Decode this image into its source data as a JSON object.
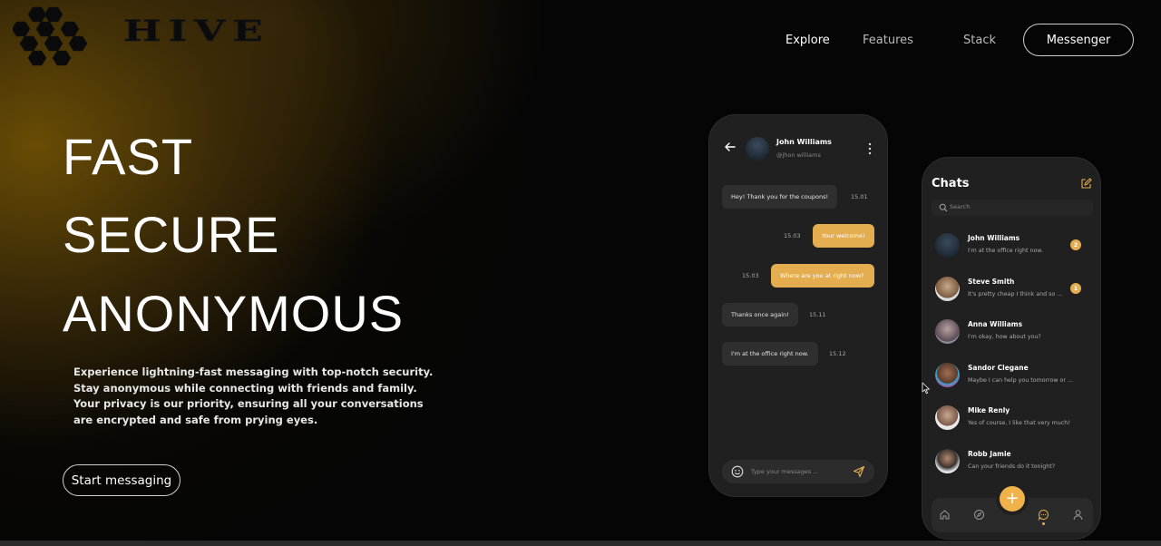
{
  "header": {
    "brand": "HIVE",
    "nav": {
      "explore": "Explore",
      "features": "Features",
      "stack": "Stack"
    },
    "messenger_button": "Messenger"
  },
  "hero": {
    "lines": [
      "FAST",
      "SECURE",
      "ANONYMOUS"
    ],
    "description": [
      "Experience lightning-fast messaging with top-notch security.",
      "Stay anonymous while connecting with friends and family.",
      "Your privacy is our priority, ensuring all your conversations",
      "are encrypted and safe from prying eyes."
    ],
    "cta": "Start messaging"
  },
  "chat_phone": {
    "contact_name": "John Williams",
    "contact_handle": "@jhon williams",
    "messages": [
      {
        "text": "Hey! Thank you for the coupons!",
        "time": "15.01",
        "direction": "in"
      },
      {
        "text": "Your welcome!",
        "time": "15.03",
        "direction": "out"
      },
      {
        "text": "Where are you at right now?",
        "time": "15.03",
        "direction": "out"
      },
      {
        "text": "Thanks once again!",
        "time": "15.11",
        "direction": "in"
      },
      {
        "text": "I'm at the office right now.",
        "time": "15.12",
        "direction": "in"
      }
    ],
    "input_placeholder": "Type your messages ..."
  },
  "chats_phone": {
    "title": "Chats",
    "search_placeholder": "Search",
    "chats": [
      {
        "name": "John Williams",
        "message": "I'm at the office right now.",
        "badge": "2"
      },
      {
        "name": "Steve Smith",
        "message": "It's pretty cheap I think and so ...",
        "badge": "1"
      },
      {
        "name": "Anna Williams",
        "message": "I'm okay, how about you?",
        "badge": ""
      },
      {
        "name": "Sandor Clegane",
        "message": "Maybe I can help you tomorrow or ...",
        "badge": ""
      },
      {
        "name": "Mike Renly",
        "message": "Yes of course, I like that very much!",
        "badge": ""
      },
      {
        "name": "Robb Jamie",
        "message": "Can your friends do it tonight?",
        "badge": ""
      }
    ],
    "fab_label": "+"
  },
  "colors": {
    "accent": "#e4ae50",
    "background": "#050505",
    "phone": "#202020"
  },
  "icons": [
    "honeycomb-logo-icon",
    "back-arrow-icon",
    "more-vertical-icon",
    "emoji-icon",
    "send-icon",
    "edit-icon",
    "search-icon",
    "home-icon",
    "compass-icon",
    "chat-bubble-icon",
    "user-icon",
    "cursor-icon"
  ]
}
